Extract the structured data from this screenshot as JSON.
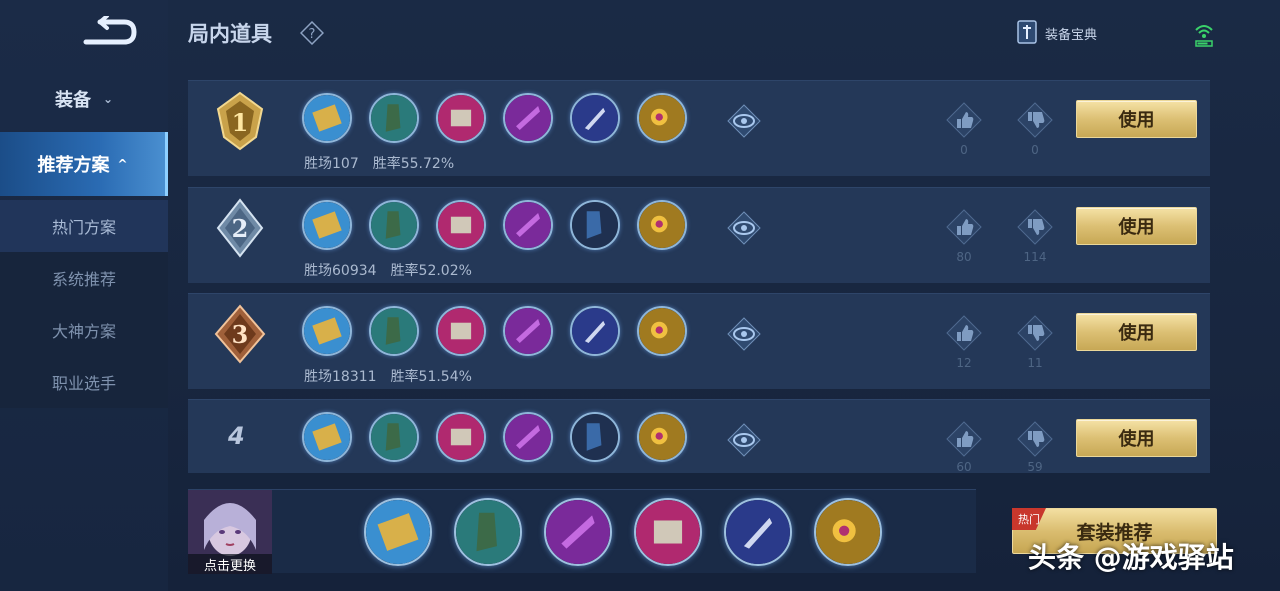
{
  "header": {
    "title": "局内道具",
    "codex_label": "装备宝典"
  },
  "sidebar": {
    "equip_label": "装备",
    "recommend_label": "推荐方案",
    "items": [
      {
        "label": "热门方案"
      },
      {
        "label": "系统推荐"
      },
      {
        "label": "大神方案"
      },
      {
        "label": "职业选手"
      }
    ]
  },
  "rows": [
    {
      "rank": "1",
      "wins_label": "胜场107",
      "rate_label": "胜率55.72%",
      "likes": "0",
      "dislikes": "0",
      "use_label": "使用"
    },
    {
      "rank": "2",
      "wins_label": "胜场60934",
      "rate_label": "胜率52.02%",
      "likes": "80",
      "dislikes": "114",
      "use_label": "使用"
    },
    {
      "rank": "3",
      "wins_label": "胜场18311",
      "rate_label": "胜率51.54%",
      "likes": "12",
      "dislikes": "11",
      "use_label": "使用"
    },
    {
      "rank": "4",
      "wins_label": "",
      "rate_label": "",
      "likes": "60",
      "dislikes": "59",
      "use_label": "使用"
    }
  ],
  "bottom": {
    "avatar_label": "点击更换",
    "suit_label": "套装推荐",
    "hot_tag": "热门"
  },
  "watermark": "头条 @游戏驿站",
  "colors": {
    "accent": "#2a6bb3",
    "gold_button": "#dcc074"
  }
}
